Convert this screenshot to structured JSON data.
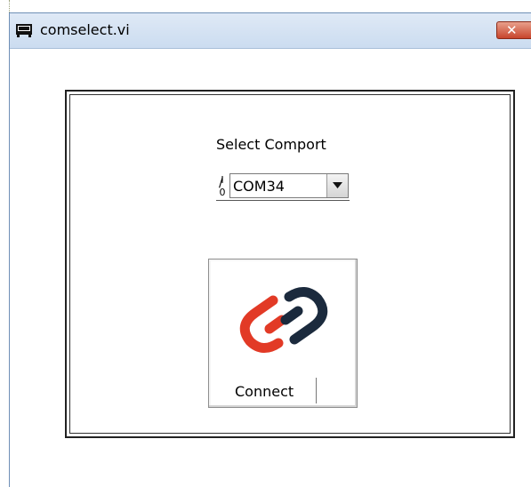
{
  "window": {
    "title": "comselect.vi",
    "close_label": "✕"
  },
  "select": {
    "label": "Select Comport",
    "io_top": "I",
    "io_bottom": "0",
    "value": "COM34"
  },
  "connect": {
    "label": "Connect",
    "icon": "link-chain-icon",
    "colors": {
      "red_link": "#e23a26",
      "navy_link": "#1b2a3d"
    }
  }
}
